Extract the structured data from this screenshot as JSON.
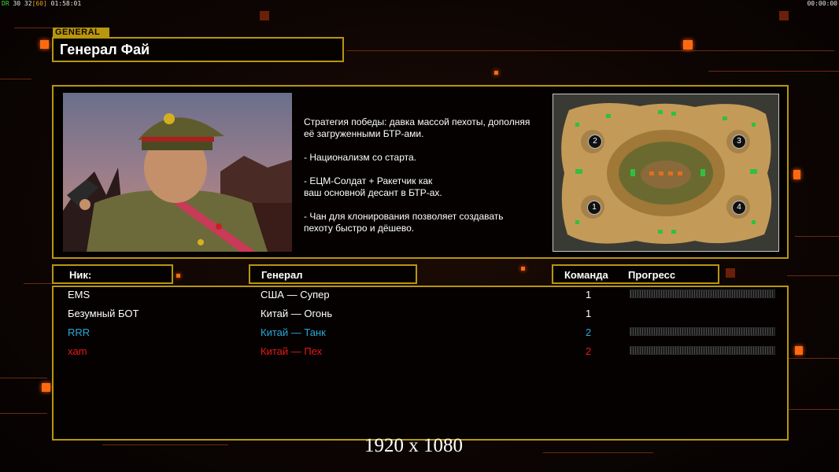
{
  "hud": {
    "left_prefix": "DR",
    "left_fps": "30 32",
    "left_bracket": "[60]",
    "left_time": "01:58:01",
    "right_time": "00:00:00"
  },
  "general_tag": "GENERAL",
  "general_name": "Генерал Фай",
  "strategy": [
    "Стратегия победы: давка массой пехоты, дополняя\n её загруженными БТР-ами.",
    "- Национализм со старта.",
    "- ЕЦМ-Солдат + Ракетчик как\nваш основной десант в БТР-ах.",
    "- Чан для клонирования позволяет создавать\n пехоту быстро и дёшево."
  ],
  "map": {
    "spawn_labels": [
      "2",
      "3",
      "1",
      "4"
    ]
  },
  "table": {
    "headers": {
      "nick": "Ник:",
      "general": "Генерал",
      "team": "Команда",
      "progress": "Прогресс"
    },
    "rows": [
      {
        "nick": "EMS",
        "general": "США — Супер",
        "team": "1",
        "color": "#ffffff",
        "show_progress": true
      },
      {
        "nick": "Безумный БОТ",
        "general": "Китай — Огонь",
        "team": "1",
        "color": "#ffffff",
        "show_progress": false
      },
      {
        "nick": "RRR",
        "general": "Китай — Танк",
        "team": "2",
        "color": "#2aa8d8",
        "show_progress": true
      },
      {
        "nick": "xam",
        "general": "Китай — Пех",
        "team": "2",
        "color": "#e81818",
        "show_progress": true
      }
    ]
  },
  "resolution": "1920 x 1080",
  "colors": {
    "accent": "#b8960e",
    "glow": "#ff6a10",
    "team_blue": "#2aa8d8",
    "team_red": "#e81818"
  }
}
